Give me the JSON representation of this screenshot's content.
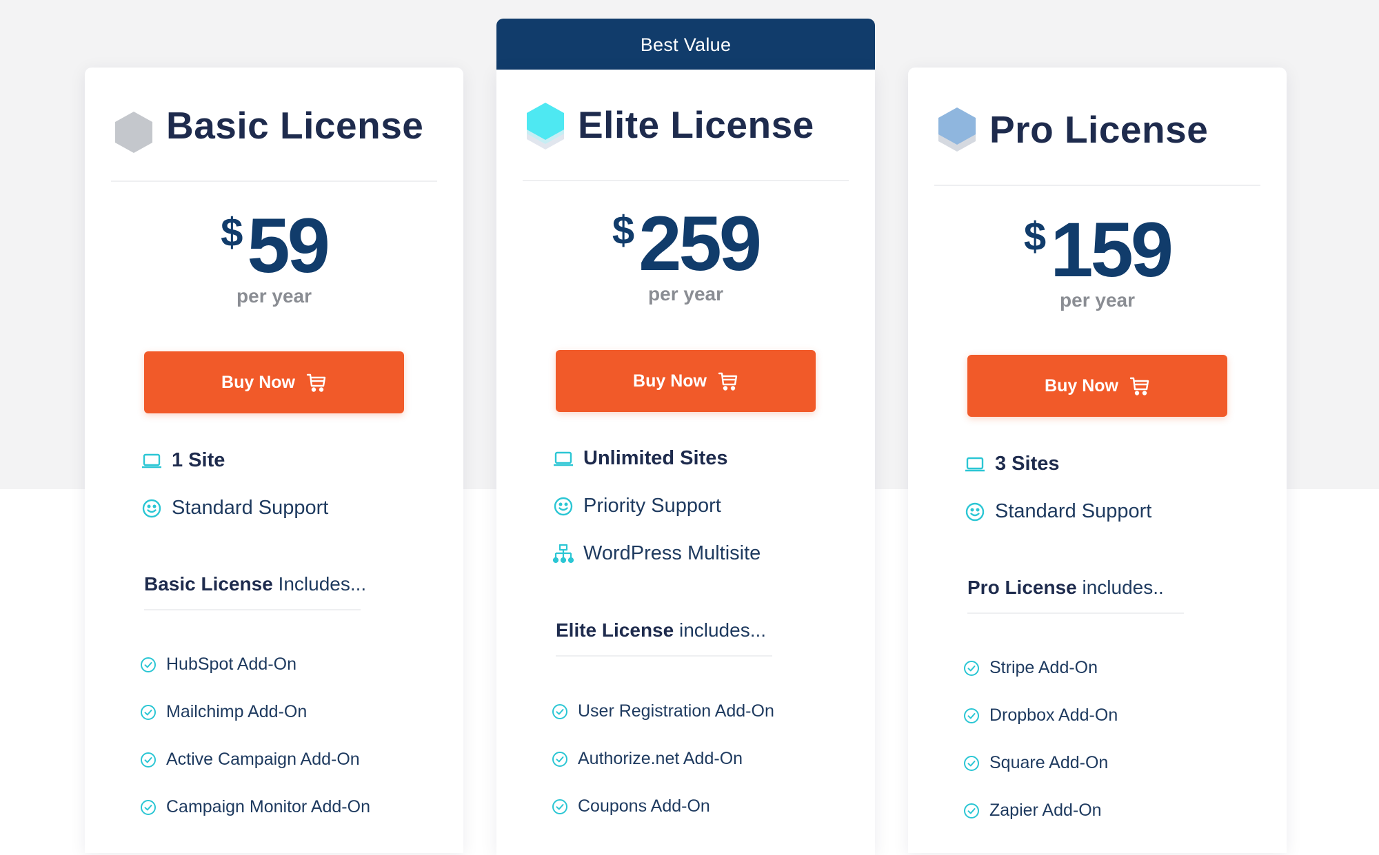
{
  "colors": {
    "navy": "#113c6b",
    "title": "#1e2b4d",
    "accent_orange": "#f15a29",
    "teal_icon": "#2bc6d4",
    "muted_text": "#8a8d93",
    "basic_hex": "#c4c7cc",
    "elite_hex": "#4ee8f2",
    "pro_hex": "#8fb6de"
  },
  "banner": {
    "label": "Best Value"
  },
  "plans": {
    "basic": {
      "title": "Basic License",
      "icon": "hexagon-grey-icon",
      "currency": "$",
      "price": "59",
      "period": "per year",
      "buy_label": "Buy Now",
      "features": [
        "1 Site",
        "Standard Support"
      ],
      "includes_bold": "Basic License",
      "includes_rest": " Includes...",
      "addons": [
        "HubSpot Add-On",
        "Mailchimp Add-On",
        "Active Campaign Add-On",
        "Campaign Monitor Add-On"
      ]
    },
    "elite": {
      "title": "Elite License",
      "icon": "hexagon-stack-cyan-icon",
      "currency": "$",
      "price": "259",
      "period": "per year",
      "buy_label": "Buy Now",
      "features": [
        "Unlimited Sites",
        "Priority Support",
        "WordPress Multisite"
      ],
      "includes_bold": "Elite License",
      "includes_rest": " includes...",
      "addons": [
        "User Registration Add-On",
        "Authorize.net Add-On",
        "Coupons Add-On"
      ]
    },
    "pro": {
      "title": "Pro License",
      "icon": "hexagon-stack-blue-icon",
      "currency": "$",
      "price": "159",
      "period": "per year",
      "buy_label": "Buy Now",
      "features": [
        "3 Sites",
        "Standard Support"
      ],
      "includes_bold": "Pro License",
      "includes_rest": " includes..",
      "addons": [
        "Stripe Add-On",
        "Dropbox Add-On",
        "Square Add-On",
        "Zapier Add-On"
      ]
    }
  }
}
